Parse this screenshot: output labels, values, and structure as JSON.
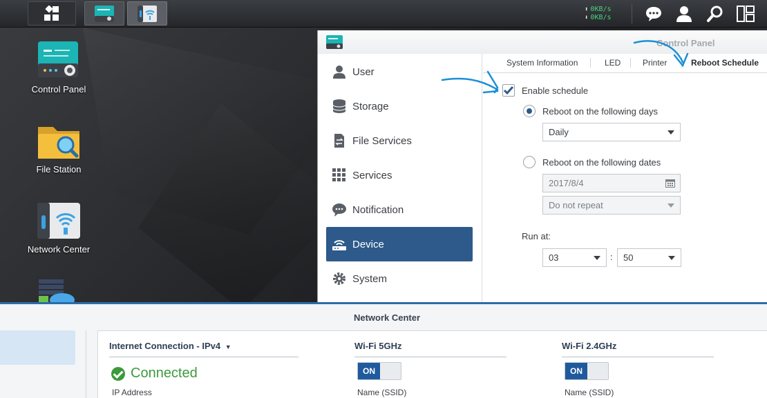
{
  "taskbar": {
    "upload_speed": "0KB/s",
    "download_speed": "0KB/s",
    "up_arrow": "⬆",
    "down_arrow": "⬇"
  },
  "desktop": {
    "icons": [
      {
        "label": "Control Panel"
      },
      {
        "label": "File Station"
      },
      {
        "label": "Network Center"
      }
    ]
  },
  "control_panel": {
    "title": "Control Panel",
    "sidebar": [
      {
        "label": "User",
        "icon": "user-icon"
      },
      {
        "label": "Storage",
        "icon": "storage-icon"
      },
      {
        "label": "File Services",
        "icon": "file-services-icon"
      },
      {
        "label": "Services",
        "icon": "services-icon"
      },
      {
        "label": "Notification",
        "icon": "notification-icon"
      },
      {
        "label": "Device",
        "icon": "device-icon",
        "active": true
      },
      {
        "label": "System",
        "icon": "system-icon"
      }
    ],
    "tabs": [
      "System Information",
      "LED",
      "Printer",
      "Reboot Schedule"
    ],
    "active_tab": "Reboot Schedule",
    "form": {
      "enable_schedule_label": "Enable schedule",
      "enable_schedule_checked": true,
      "option_days_label": "Reboot on the following days",
      "option_days_selected": true,
      "days_value": "Daily",
      "option_dates_label": "Reboot on the following dates",
      "date_value": "2017/8/4",
      "repeat_value": "Do not repeat",
      "run_at_label": "Run at:",
      "hour_value": "03",
      "time_colon": ":",
      "minute_value": "50"
    }
  },
  "network_center": {
    "title": "Network Center",
    "internet_heading": "Internet Connection - IPv4",
    "status": "Connected",
    "ip_label": "IP Address",
    "wifi5_heading": "Wi-Fi 5GHz",
    "wifi24_heading": "Wi-Fi 2.4GHz",
    "toggle_on": "ON",
    "ssid_label": "Name (SSID)"
  },
  "colors": {
    "accent": "#2d5a8b",
    "connected": "#3c9a3c",
    "annotation": "#1a8fd6"
  }
}
